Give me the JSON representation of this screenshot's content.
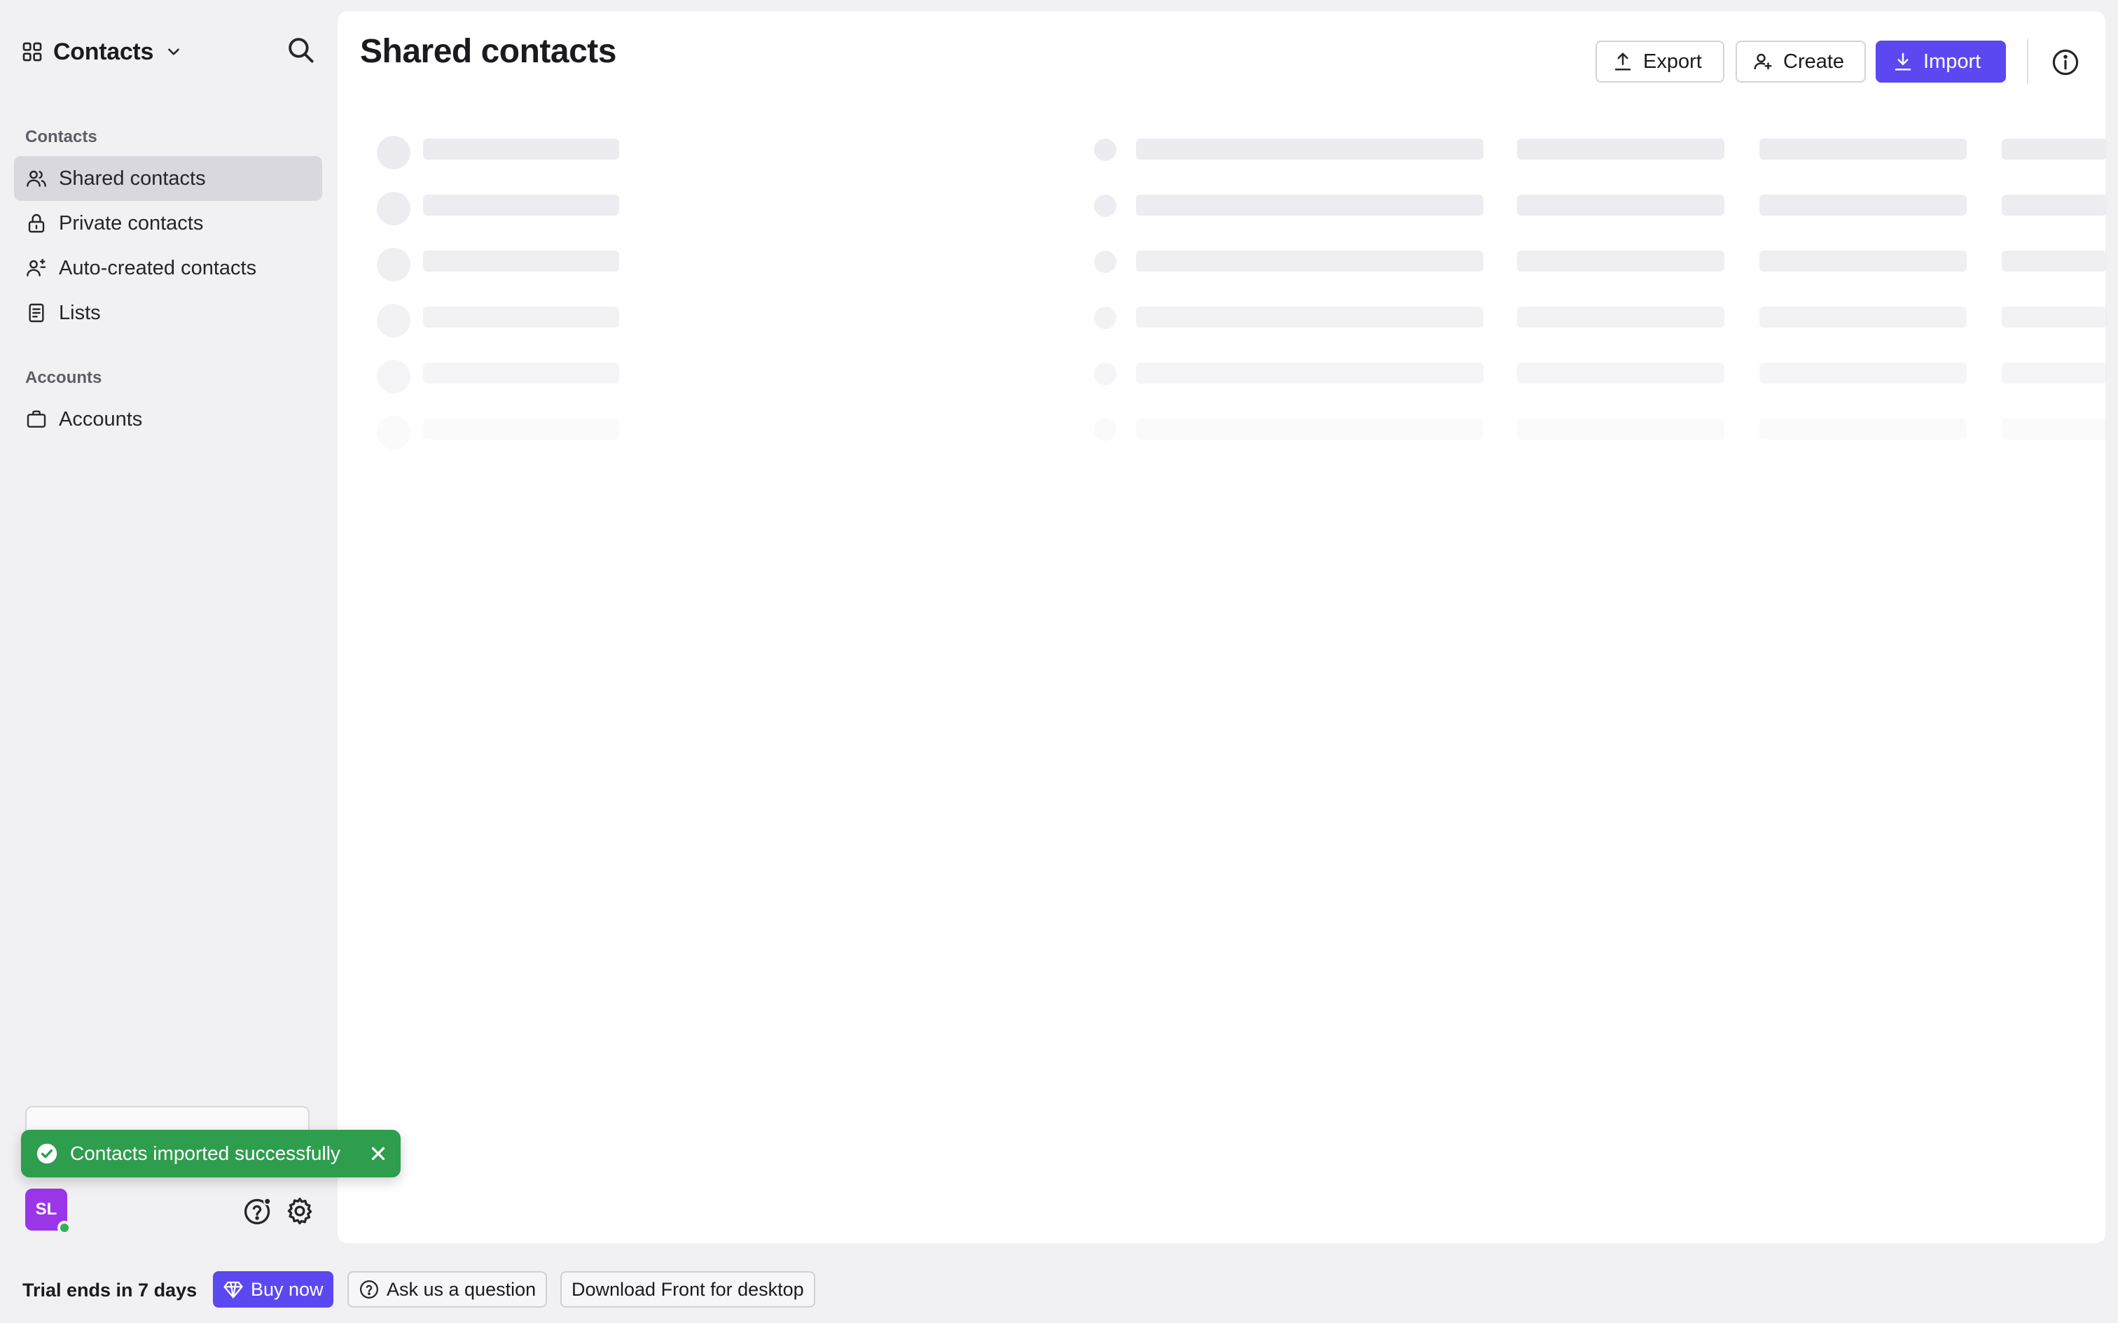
{
  "sidebar": {
    "app_title": "Contacts",
    "sections": [
      {
        "label": "Contacts",
        "items": [
          {
            "label": "Shared contacts",
            "icon": "users-icon",
            "active": true
          },
          {
            "label": "Private contacts",
            "icon": "lock-icon",
            "active": false
          },
          {
            "label": "Auto-created contacts",
            "icon": "auto-user-icon",
            "active": false
          },
          {
            "label": "Lists",
            "icon": "list-icon",
            "active": false
          }
        ]
      },
      {
        "label": "Accounts",
        "items": [
          {
            "label": "Accounts",
            "icon": "briefcase-icon",
            "active": false
          }
        ]
      }
    ],
    "user_initials": "SL"
  },
  "toast": {
    "message": "Contacts imported successfully",
    "color": "#2f9d4e"
  },
  "main": {
    "title": "Shared contacts",
    "actions": {
      "export_label": "Export",
      "create_label": "Create",
      "import_label": "Import"
    },
    "loading": true
  },
  "bottombar": {
    "trial_text": "Trial ends in 7 days",
    "buy_label": "Buy now",
    "ask_label": "Ask us a question",
    "download_label": "Download Front for desktop"
  },
  "colors": {
    "accent": "#5b48f0",
    "avatar": "#9a36e8",
    "sidebar_bg": "#f1f0f3",
    "active_item_bg": "#d9d8de"
  }
}
